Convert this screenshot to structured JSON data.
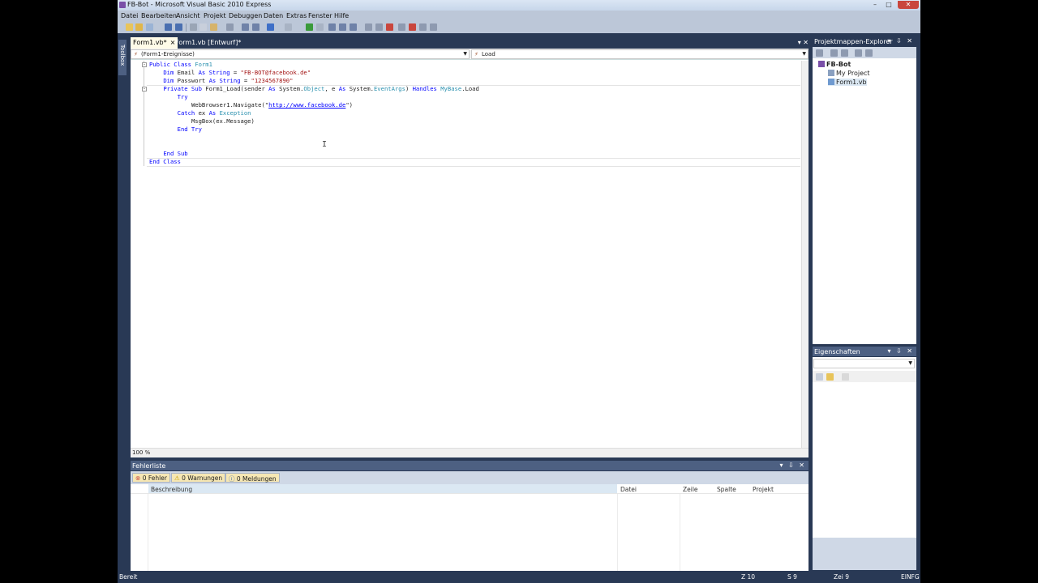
{
  "window": {
    "title": "FB-Bot - Microsoft Visual Basic 2010 Express"
  },
  "menu": [
    "Datei",
    "Bearbeiten",
    "Ansicht",
    "Projekt",
    "Debuggen",
    "Daten",
    "Extras",
    "Fenster",
    "Hilfe"
  ],
  "toolbox": {
    "label": "Toolbox"
  },
  "tabs": [
    {
      "label": "Form1.vb*",
      "close": "×"
    },
    {
      "label": "Form1.vb [Entwurf]*"
    }
  ],
  "editor": {
    "class_combo": "(Form1-Ereignisse)",
    "method_combo": "Load",
    "zoom": "100 %",
    "code": {
      "l1_kw": "Public Class ",
      "l1_ty": "Form1",
      "l2_kw1": "Dim ",
      "l2_name": "Email ",
      "l2_kw2": "As String",
      "l2_eq": " = ",
      "l2_str": "\"FB-BOT@facebook.de\"",
      "l3_kw1": "Dim ",
      "l3_name": "Passwort ",
      "l3_kw2": "As String",
      "l3_eq": " = ",
      "l3_str": "\"1234567890\"",
      "l4_kw1": "Private Sub ",
      "l4_a": "Form1_Load(sender ",
      "l4_kw2": "As ",
      "l4_b": "System.",
      "l4_ty1": "Object",
      "l4_c": ", e ",
      "l4_kw3": "As ",
      "l4_d": "System.",
      "l4_ty2": "EventArgs",
      "l4_e": ") ",
      "l4_kw4": "Handles ",
      "l4_ty3": "MyBase",
      "l4_f": ".Load",
      "l5": "Try",
      "l6_a": "WebBrowser1.Navigate(\"",
      "l6_url": "http://www.facebook.de",
      "l6_b": "\")",
      "l7_kw": "Catch ",
      "l7_a": "ex ",
      "l7_kw2": "As ",
      "l7_ty": "Exception",
      "l8": "MsgBox(ex.Message)",
      "l9": "End Try",
      "l10": "End Sub",
      "l11": "End Class"
    }
  },
  "solution_explorer": {
    "title": "Projektmappen-Explorer",
    "items": [
      "FB-Bot",
      "My Project",
      "Form1.vb"
    ]
  },
  "properties": {
    "title": "Eigenschaften"
  },
  "error_list": {
    "title": "Fehlerliste",
    "filters": [
      "0 Fehler",
      "0 Warnungen",
      "0 Meldungen"
    ],
    "columns": [
      "Beschreibung",
      "Datei",
      "Zeile",
      "Spalte",
      "Projekt"
    ]
  },
  "status": {
    "ready": "Bereit",
    "line": "Z 10",
    "col": "S 9",
    "char": "Zei 9",
    "mode": "EINFG"
  }
}
